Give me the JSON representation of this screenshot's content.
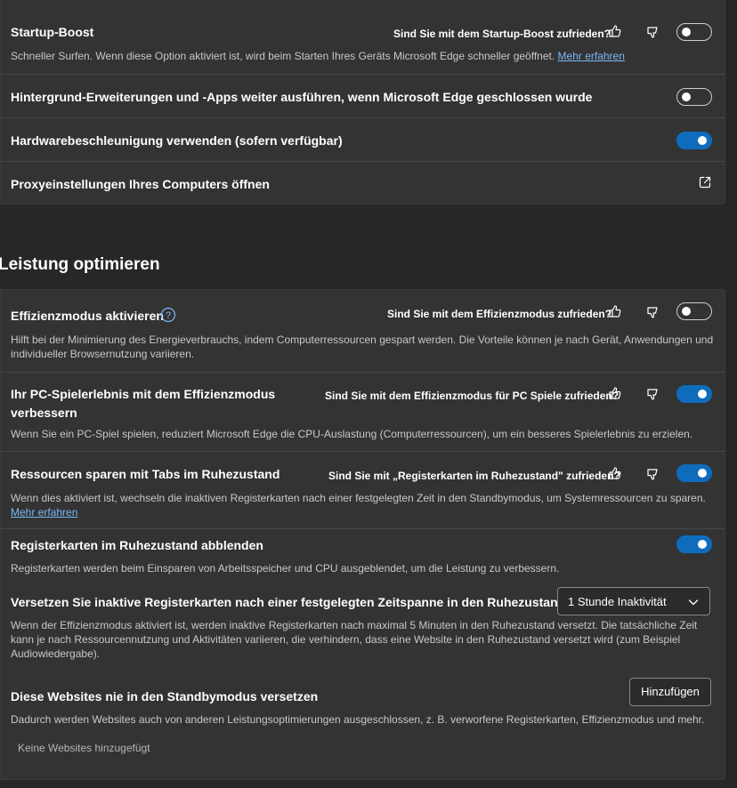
{
  "system": {
    "startup_boost": {
      "title": "Startup-Boost",
      "feedback": "Sind Sie mit dem Startup-Boost zufrieden?",
      "desc": "Schneller Surfen. Wenn diese Option aktiviert ist, wird beim Starten Ihres Geräts Microsoft Edge schneller geöffnet.",
      "link": "Mehr erfahren",
      "enabled": false
    },
    "background_apps": {
      "title": "Hintergrund-Erweiterungen und -Apps weiter ausführen, wenn Microsoft Edge geschlossen wurde",
      "enabled": false
    },
    "hardware_accel": {
      "title": "Hardwarebeschleunigung verwenden (sofern verfügbar)",
      "enabled": true
    },
    "proxy": {
      "title": "Proxyeinstellungen Ihres Computers öffnen",
      "icon": "external-link-icon"
    }
  },
  "performance": {
    "section_title": "Leistung optimieren",
    "efficiency_mode": {
      "title": "Effizienzmodus aktivieren",
      "feedback": "Sind Sie mit dem Effizienzmodus zufrieden?",
      "desc_line1": "Hilft bei der Minimierung des Energieverbrauchs, indem Computerressourcen gespart werden. Die Vorteile können je nach Gerät, Anwendungen und",
      "desc_line2": "individueller Browsernutzung variieren.",
      "enabled": false
    },
    "pc_gaming": {
      "title_line1": "Ihr PC-Spielerlebnis mit dem Effizienzmodus",
      "title_line2": "verbessern",
      "feedback": "Sind Sie mit dem Effizienzmodus für PC Spiele zufrieden?",
      "desc": "Wenn Sie ein PC-Spiel spielen, reduziert Microsoft Edge die CPU-Auslastung (Computerressourcen), um ein besseres Spielerlebnis zu erzielen.",
      "enabled": true
    },
    "sleeping_tabs": {
      "title": "Ressourcen sparen mit Tabs im Ruhezustand",
      "feedback": "Sind Sie mit „Registerkarten im Ruhezustand\" zufrieden?",
      "desc": "Wenn dies aktiviert ist, wechseln die inaktiven Registerkarten nach einer festgelegten Zeit in den Standbymodus, um Systemressourcen zu sparen.",
      "link": "Mehr erfahren",
      "enabled": true
    },
    "fade_tabs": {
      "title": "Registerkarten im Ruhezustand abblenden",
      "desc": "Registerkarten werden beim Einsparen von Arbeitsspeicher und CPU ausgeblendet, um die Leistung zu verbessern.",
      "enabled": true
    },
    "sleep_timeout": {
      "title": "Versetzen Sie inaktive Registerkarten nach einer festgelegten Zeitspanne in den Ruhezustand:",
      "selected": "1 Stunde Inaktivität",
      "desc_line1": "Wenn der Effizienzmodus aktiviert ist, werden inaktive Registerkarten nach maximal 5 Minuten in den Ruhezustand versetzt. Die tatsächliche Zeit",
      "desc_line2": "kann je nach Ressourcennutzung und Aktivitäten variieren, die verhindern, dass eine Website in den Ruhezustand versetzt wird (zum Beispiel",
      "desc_line3": "Audiowiedergabe)."
    },
    "never_sleep": {
      "title": "Diese Websites nie in den Standbymodus versetzen",
      "button": "Hinzufügen",
      "desc": "Dadurch werden Websites auch von anderen Leistungsoptimierungen ausgeschlossen, z. B. verworfene Registerkarten, Effizienzmodus und mehr.",
      "empty": "Keine Websites hinzugefügt"
    }
  },
  "colors": {
    "background": "#272727",
    "card": "#333333",
    "accent": "#0f6cbd",
    "link": "#79b8f4"
  }
}
